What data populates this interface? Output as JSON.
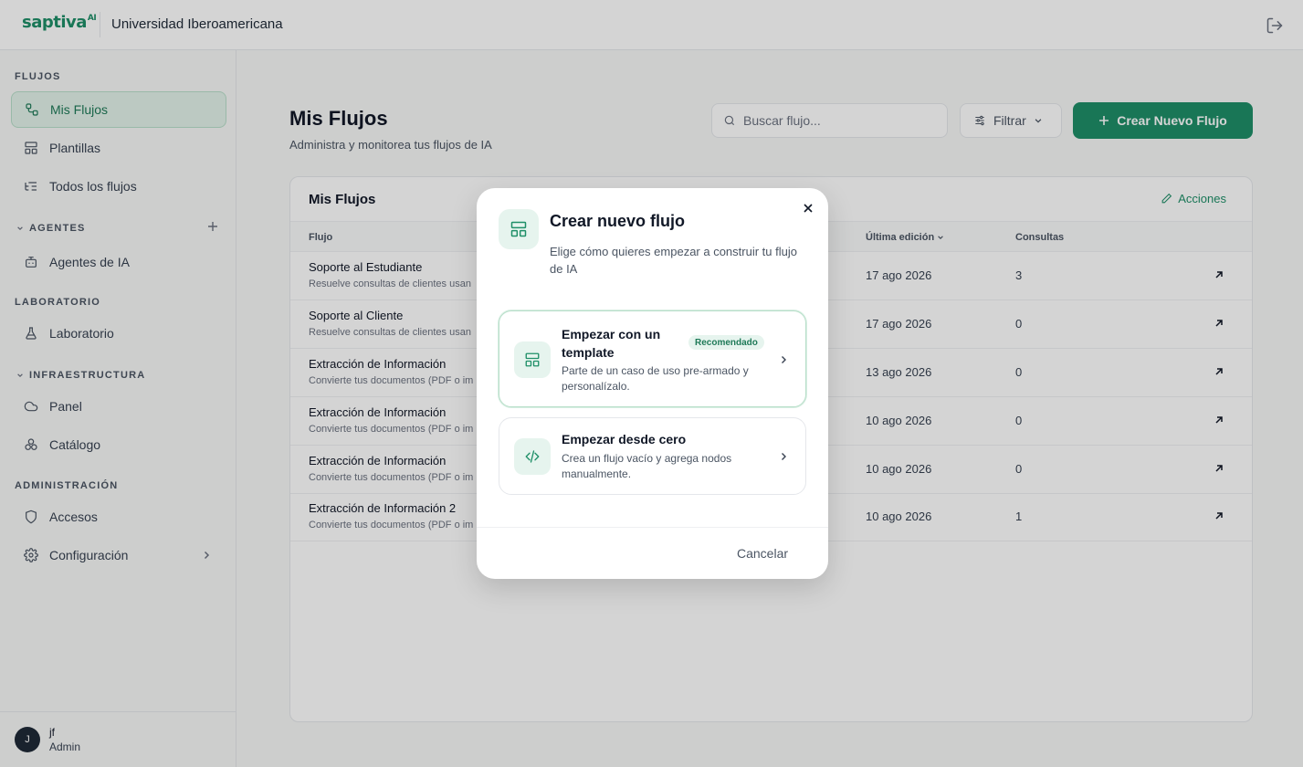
{
  "header": {
    "logo_text": "saptiva",
    "logo_suffix": "AI",
    "org_name": "Universidad Iberoamericana"
  },
  "sidebar": {
    "sections": {
      "flujos": "FLUJOS",
      "agentes": "AGENTES",
      "laboratorio": "LABORATORIO",
      "infraestructura": "INFRAESTRUCTURA",
      "administracion": "ADMINISTRACIÓN"
    },
    "items": {
      "mis_flujos": "Mis Flujos",
      "plantillas": "Plantillas",
      "todos_flujos": "Todos los flujos",
      "agentes_ia": "Agentes de IA",
      "laboratorio": "Laboratorio",
      "panel": "Panel",
      "catalogo": "Catálogo",
      "accesos": "Accesos",
      "configuracion": "Configuración"
    },
    "user": {
      "initial": "J",
      "name": "jf",
      "role": "Admin"
    }
  },
  "main": {
    "title": "Mis Flujos",
    "subtitle": "Administra y monitorea tus flujos de IA",
    "search_placeholder": "Buscar flujo...",
    "filter_label": "Filtrar",
    "create_label": "Crear Nuevo Flujo",
    "card_title": "Mis Flujos",
    "actions_label": "Acciones",
    "columns": {
      "flujo": "Flujo",
      "ultima_edicion": "Última edición",
      "consultas": "Consultas"
    },
    "rows": [
      {
        "name": "Soporte al Estudiante",
        "desc": "Resuelve consultas de clientes usan",
        "date": "17 ago 2026",
        "count": "3"
      },
      {
        "name": "Soporte al Cliente",
        "desc": "Resuelve consultas de clientes usan",
        "date": "17 ago 2026",
        "count": "0"
      },
      {
        "name": "Extracción de Información",
        "desc": "Convierte tus documentos (PDF o im",
        "date": "13 ago 2026",
        "count": "0"
      },
      {
        "name": "Extracción de Información",
        "desc": "Convierte tus documentos (PDF o im",
        "date": "10 ago 2026",
        "count": "0"
      },
      {
        "name": "Extracción de Información",
        "desc": "Convierte tus documentos (PDF o im",
        "date": "10 ago 2026",
        "count": "0"
      },
      {
        "name": "Extracción de Información 2",
        "desc": "Convierte tus documentos (PDF o im",
        "date": "10 ago 2026",
        "count": "1"
      }
    ]
  },
  "modal": {
    "title": "Crear nuevo flujo",
    "description": "Elige cómo quieres empezar a construir tu flujo de IA",
    "option_template": {
      "title": "Empezar con un template",
      "badge": "Recomendado",
      "desc": "Parte de un caso de uso pre-armado y personalízalo."
    },
    "option_scratch": {
      "title": "Empezar desde cero",
      "desc": "Crea un flujo vacío y agrega nodos manualmente."
    },
    "cancel_label": "Cancelar"
  },
  "colors": {
    "brand": "#1f8f68",
    "brand_light": "#e6f4ee"
  }
}
